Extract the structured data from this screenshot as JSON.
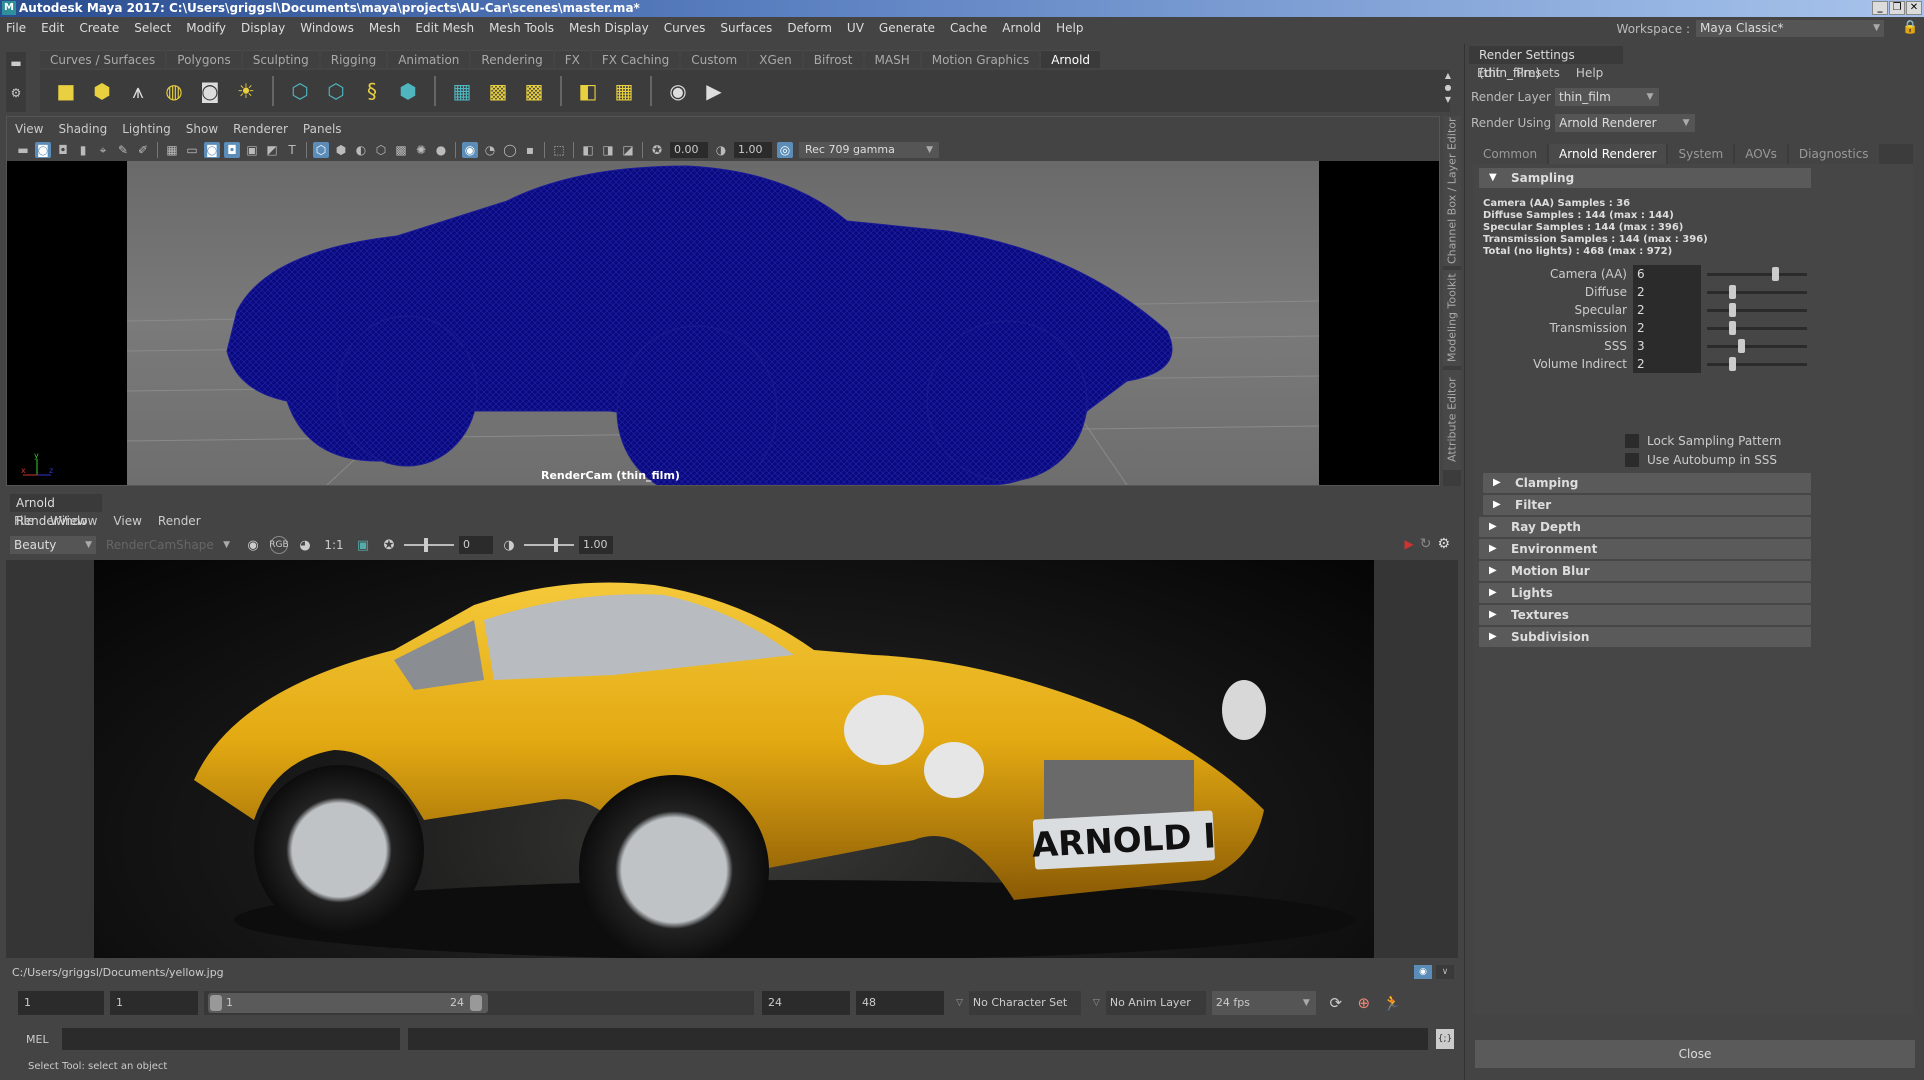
{
  "window": {
    "title": "Autodesk Maya 2017: C:\\Users\\griggsl\\Documents\\maya\\projects\\AU-Car\\scenes\\master.ma*",
    "logo": "M",
    "controls": [
      "_",
      "❐",
      "✕"
    ]
  },
  "menubar": {
    "items": [
      "File",
      "Edit",
      "Create",
      "Select",
      "Modify",
      "Display",
      "Windows",
      "Mesh",
      "Edit Mesh",
      "Mesh Tools",
      "Mesh Display",
      "Curves",
      "Surfaces",
      "Deform",
      "UV",
      "Generate",
      "Cache",
      "Arnold",
      "Help"
    ],
    "workspace_label": "Workspace :",
    "workspace_value": "Maya Classic*"
  },
  "shelf": {
    "tabs": [
      "Curves / Surfaces",
      "Polygons",
      "Sculpting",
      "Rigging",
      "Animation",
      "Rendering",
      "FX",
      "FX Caching",
      "Custom",
      "XGen",
      "Bifrost",
      "MASH",
      "Motion Graphics",
      "Arnold"
    ],
    "active_tab": "Arnold",
    "icons": [
      {
        "name": "area-light-icon",
        "glyph": "■",
        "cls": "y"
      },
      {
        "name": "mesh-light-icon",
        "glyph": "⬢",
        "cls": "y"
      },
      {
        "name": "photometric-light-icon",
        "glyph": "⩚",
        "cls": "w"
      },
      {
        "name": "skydome-light-icon",
        "glyph": "◍",
        "cls": "y"
      },
      {
        "name": "skydome-image-light-icon",
        "glyph": "◙",
        "cls": "w"
      },
      {
        "name": "physical-sky-icon",
        "glyph": "☀",
        "cls": "y"
      },
      {
        "name": "sep"
      },
      {
        "name": "create-standin-icon",
        "glyph": "⬡",
        "cls": "c"
      },
      {
        "name": "export-standin-icon",
        "glyph": "⬡",
        "cls": "c"
      },
      {
        "name": "curve-collector-icon",
        "glyph": "§",
        "cls": "y"
      },
      {
        "name": "volume-icon",
        "glyph": "⬢",
        "cls": "c"
      },
      {
        "name": "sep"
      },
      {
        "name": "render-view-icon",
        "glyph": "▦",
        "cls": "c"
      },
      {
        "name": "flush-texture-cache-icon",
        "glyph": "▩",
        "cls": "y"
      },
      {
        "name": "remove-texture-icon",
        "glyph": "▩",
        "cls": "y"
      },
      {
        "name": "sep"
      },
      {
        "name": "tx-manager-icon",
        "glyph": "◧",
        "cls": "y"
      },
      {
        "name": "tx-texture-icon",
        "glyph": "▦",
        "cls": "y"
      },
      {
        "name": "sep"
      },
      {
        "name": "ipr-view-icon",
        "glyph": "◉",
        "cls": "w"
      },
      {
        "name": "render-icon",
        "glyph": "▶",
        "cls": "w"
      }
    ]
  },
  "viewport": {
    "menu": [
      "View",
      "Shading",
      "Lighting",
      "Show",
      "Renderer",
      "Panels"
    ],
    "exposure": "0.00",
    "gamma": "1.00",
    "color_space": "Rec 709 gamma",
    "camera_label": "RenderCam (thin_film)",
    "axis": {
      "x": "x",
      "y": "y",
      "z": "z"
    }
  },
  "side_tabs": [
    "Channel Box / Layer Editor",
    "Modeling Toolkit",
    "Attribute Editor"
  ],
  "renderview": {
    "title": "Arnold RenderView",
    "menu": [
      "File",
      "Window",
      "View",
      "Render"
    ],
    "aov": "Beauty",
    "camera": "RenderCamShape",
    "ratio": "1:1",
    "exposure": "0",
    "gamma": "1.00",
    "plate_text": "ARNOLD I",
    "image_path": "C:/Users/griggsl/Documents/yellow.jpg"
  },
  "timeline": {
    "start": "1",
    "playback_start": "1",
    "range_start": "1",
    "range_end": "24",
    "playback_end": "24",
    "end": "48",
    "character_set": "No Character Set",
    "anim_layer": "No Anim Layer",
    "fps": "24 fps"
  },
  "command_line": {
    "label": "MEL",
    "input": "",
    "help": "Select Tool: select an object"
  },
  "render_settings": {
    "title": "Render Settings (thin_film)",
    "menu": [
      "Edit",
      "Presets",
      "Help"
    ],
    "render_layer_label": "Render Layer",
    "render_layer": "thin_film",
    "render_using_label": "Render Using",
    "render_using": "Arnold Renderer",
    "tabs": [
      "Common",
      "Arnold Renderer",
      "System",
      "AOVs",
      "Diagnostics"
    ],
    "active_tab": "Arnold Renderer",
    "sampling": {
      "title": "Sampling",
      "info": [
        "Camera (AA) Samples : 36",
        "Diffuse Samples : 144 (max : 144)",
        "Specular Samples : 144 (max : 396)",
        "Transmission Samples : 144 (max : 396)",
        "Total (no lights) : 468 (max : 972)"
      ],
      "attrs": [
        {
          "label": "Camera (AA)",
          "value": "6",
          "slider": 0.7
        },
        {
          "label": "Diffuse",
          "value": "2",
          "slider": 0.24
        },
        {
          "label": "Specular",
          "value": "2",
          "slider": 0.24
        },
        {
          "label": "Transmission",
          "value": "2",
          "slider": 0.24
        },
        {
          "label": "SSS",
          "value": "3",
          "slider": 0.33
        },
        {
          "label": "Volume Indirect",
          "value": "2",
          "slider": 0.24
        }
      ],
      "checkboxes": [
        {
          "label": "Lock Sampling Pattern",
          "checked": false
        },
        {
          "label": "Use Autobump in SSS",
          "checked": false
        }
      ]
    },
    "sub_sections": [
      "Clamping",
      "Filter"
    ],
    "sections": [
      "Ray Depth",
      "Environment",
      "Motion Blur",
      "Lights",
      "Textures",
      "Subdivision"
    ],
    "close_label": "Close"
  }
}
